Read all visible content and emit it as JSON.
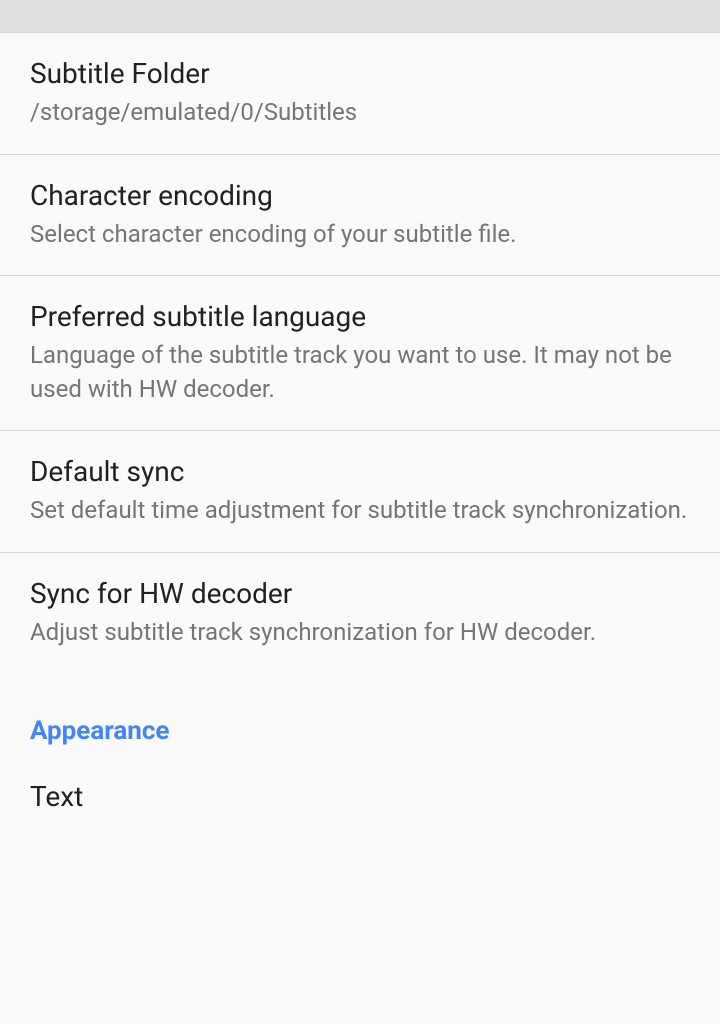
{
  "settings": [
    {
      "title": "Subtitle Folder",
      "subtitle": "/storage/emulated/0/Subtitles"
    },
    {
      "title": "Character encoding",
      "subtitle": "Select character encoding of your subtitle file."
    },
    {
      "title": "Preferred subtitle language",
      "subtitle": "Language of the subtitle track you want to use. It may not be used with HW decoder."
    },
    {
      "title": "Default sync",
      "subtitle": "Set default time adjustment for subtitle track synchronization."
    },
    {
      "title": "Sync for HW decoder",
      "subtitle": "Adjust subtitle track synchronization for HW decoder."
    }
  ],
  "section_header": "Appearance",
  "text_item": "Text"
}
